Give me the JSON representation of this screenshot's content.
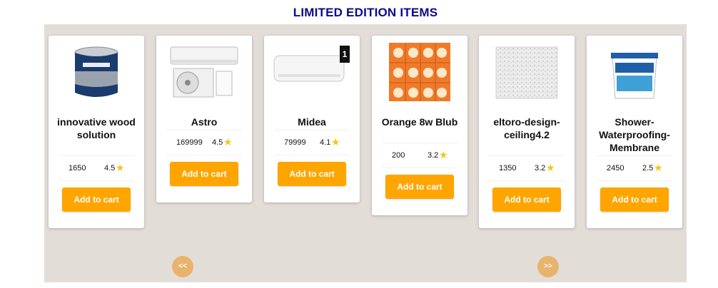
{
  "section": {
    "title": "LIMITED EDITION ITEMS"
  },
  "carousel": {
    "prev_label": "<<",
    "next_label": ">>",
    "products": [
      {
        "name": "innovative wood solution",
        "price": "1650",
        "rating": "4.5",
        "button": "Add to cart",
        "image": "paint-can"
      },
      {
        "name": "Astro",
        "price": "169999",
        "rating": "4.5",
        "button": "Add to cart",
        "image": "split-air-conditioner"
      },
      {
        "name": "Midea",
        "price": "79999",
        "rating": "4.1",
        "button": "Add to cart",
        "image": "wall-air-conditioner"
      },
      {
        "name": "Orange 8w Blub",
        "price": "200",
        "rating": "3.2",
        "button": "Add to cart",
        "image": "bulb-pack"
      },
      {
        "name": "eltoro-design-ceiling4.2",
        "price": "1350",
        "rating": "3.2",
        "button": "Add to cart",
        "image": "ceiling-tile"
      },
      {
        "name": "Shower-Waterproofing-Membrane",
        "price": "2450",
        "rating": "2.5",
        "button": "Add to cart",
        "image": "bucket"
      }
    ]
  },
  "colors": {
    "title": "#0a0a8c",
    "button": "#ffa500",
    "nav": "#e8b46d",
    "star": "#f5c518",
    "carousel_bg": "#e3ddd7"
  }
}
